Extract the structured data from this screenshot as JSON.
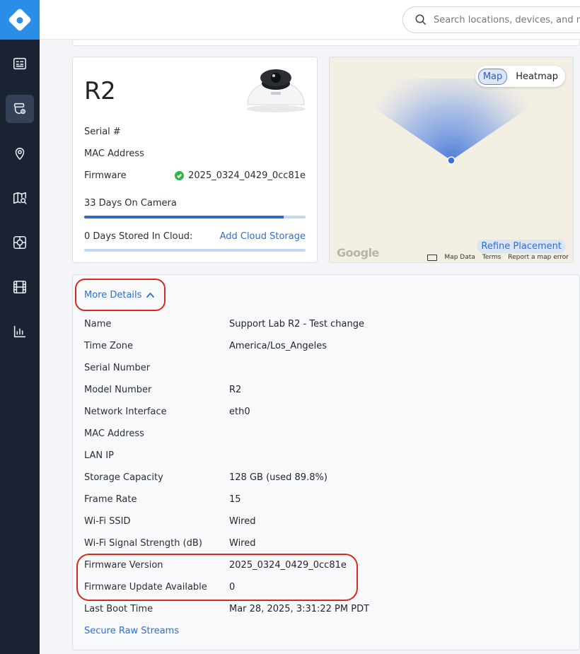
{
  "search": {
    "placeholder": "Search locations, devices, and more"
  },
  "sidebar": {
    "items": [
      {
        "icon": "dashboard-icon",
        "active": false
      },
      {
        "icon": "devices-icon",
        "active": true
      },
      {
        "icon": "location-pin-icon",
        "active": false
      },
      {
        "icon": "map-search-icon",
        "active": false
      },
      {
        "icon": "alert-dial-icon",
        "active": false
      },
      {
        "icon": "film-icon",
        "active": false
      },
      {
        "icon": "bar-chart-icon",
        "active": false
      }
    ]
  },
  "camera": {
    "name": "R2",
    "serial_label": "Serial #",
    "mac_label": "MAC Address",
    "firmware_label": "Firmware",
    "firmware_value": "2025_0324_0429_0cc81e",
    "days_on_camera": "33 Days On Camera",
    "days_on_camera_fraction": 0.9,
    "days_cloud": "0 Days Stored In Cloud:",
    "add_cloud": "Add Cloud Storage",
    "days_cloud_fraction": 0
  },
  "map": {
    "tab_map": "Map",
    "tab_heatmap": "Heatmap",
    "refine": "Refine Placement",
    "google": "Google",
    "map_data": "Map Data",
    "terms": "Terms",
    "report": "Report a map error"
  },
  "details": {
    "toggle_label": "More Details",
    "rows": [
      {
        "label": "Name",
        "value": "Support Lab R2 - Test change"
      },
      {
        "label": "Time Zone",
        "value": "America/Los_Angeles"
      },
      {
        "label": "Serial Number",
        "value": ""
      },
      {
        "label": "Model Number",
        "value": "R2"
      },
      {
        "label": "Network Interface",
        "value": "eth0"
      },
      {
        "label": "MAC Address",
        "value": ""
      },
      {
        "label": "LAN IP",
        "value": ""
      },
      {
        "label": "Storage Capacity",
        "value": "128 GB (used 89.8%)"
      },
      {
        "label": "Frame Rate",
        "value": "15"
      },
      {
        "label": "Wi-Fi SSID",
        "value": "Wired"
      },
      {
        "label": "Wi-Fi Signal Strength (dB)",
        "value": "Wired"
      },
      {
        "label": "Firmware Version",
        "value": "2025_0324_0429_0cc81e"
      },
      {
        "label": "Firmware Update Available",
        "value": "0"
      },
      {
        "label": "Last Boot Time",
        "value": "Mar 28, 2025, 3:31:22 PM PDT"
      }
    ],
    "secure_streams": "Secure Raw Streams"
  },
  "colors": {
    "brand": "#2a8de8",
    "sidebar": "#1b2232",
    "link": "#2f6fd0",
    "annotation": "#d9291c",
    "success": "#31b449"
  }
}
